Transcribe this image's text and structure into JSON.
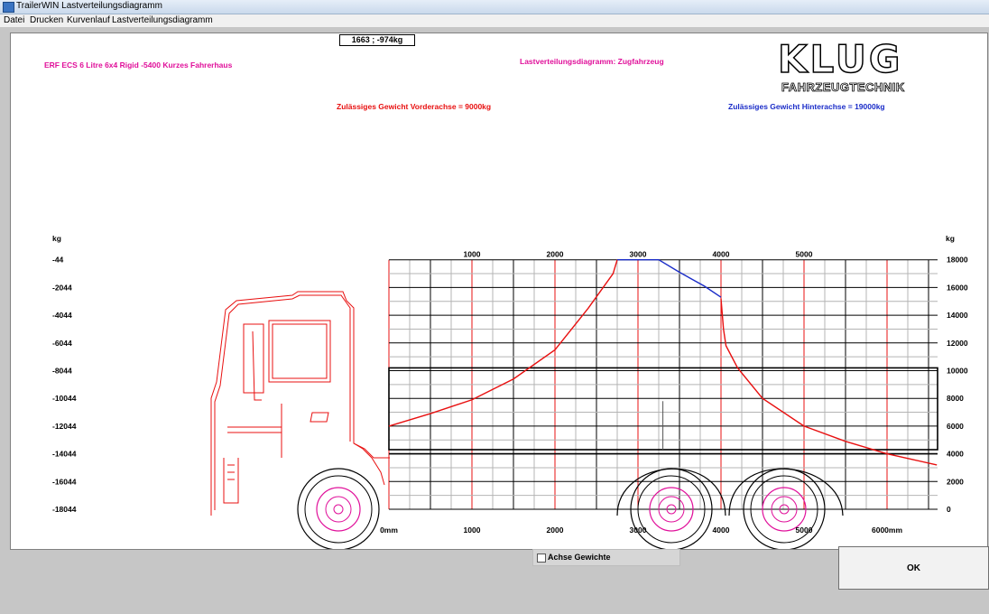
{
  "window": {
    "title": "TrailerWIN Lastverteilungsdiagramm"
  },
  "menu": {
    "items": [
      "Datei",
      "Drucken",
      "Kurvenlauf",
      "Lastverteilungsdiagramm"
    ]
  },
  "readout": "1663 ; -974kg",
  "labels": {
    "vehicle": "ERF ECS 6 Litre 6x4 Rigid -5400 Kurzes Fahrerhaus",
    "diagram_title": "Lastverteilungsdiagramm: Zugfahrzeug",
    "front_axle_limit": "Zulässiges Gewicht Vorderachse = 9000kg",
    "rear_axle_limit": "Zulässiges Gewicht Hinterachse = 19000kg"
  },
  "logo": {
    "text": "KLUG",
    "subtitle": "FAHRZEUGTECHNIK"
  },
  "colors": {
    "front": "#e81010",
    "rear": "#1a2cc8",
    "title": "#e0109a"
  },
  "checkbox": {
    "label": "Achse  Gewichte",
    "checked": false
  },
  "ok_button": {
    "label": "OK"
  },
  "chart_data": {
    "type": "line",
    "x_unit": "mm",
    "x_ticks_top": [
      "1000",
      "2000",
      "3000",
      "4000",
      "5000"
    ],
    "x_ticks_bottom": [
      "0mm",
      "1000",
      "2000",
      "3000",
      "4000",
      "5000",
      "6000mm"
    ],
    "y_unit_left": "kg",
    "y_unit_right": "kg",
    "left_axis_ticks": [
      "-44",
      "-2044",
      "-4044",
      "-6044",
      "-8044",
      "-10044",
      "-12044",
      "-14044",
      "-16044",
      "-18044"
    ],
    "right_axis_ticks": [
      "18000",
      "16000",
      "14000",
      "12000",
      "10000",
      "8000",
      "6000",
      "4000",
      "2000",
      "0"
    ],
    "ylim": [
      0,
      18000
    ],
    "xlim": [
      0,
      6600
    ],
    "series": [
      {
        "color": "#e81010",
        "x": [
          0,
          500,
          1000,
          1500,
          2000,
          2400,
          2700,
          2750
        ],
        "y": [
          6000,
          6900,
          7900,
          9400,
          11500,
          14500,
          17000,
          18000
        ]
      },
      {
        "color": "#1a2cc8",
        "x": [
          2750,
          3000,
          3250,
          3500,
          3800,
          4000
        ],
        "y": [
          18000,
          18000,
          18000,
          17100,
          16100,
          15300
        ]
      },
      {
        "color": "#e81010",
        "x": [
          4000,
          4030,
          4060,
          4200,
          4500,
          5000,
          5500,
          6000,
          6600
        ],
        "y": [
          15200,
          13000,
          11800,
          10200,
          8000,
          6000,
          4900,
          4000,
          3200
        ]
      }
    ]
  }
}
